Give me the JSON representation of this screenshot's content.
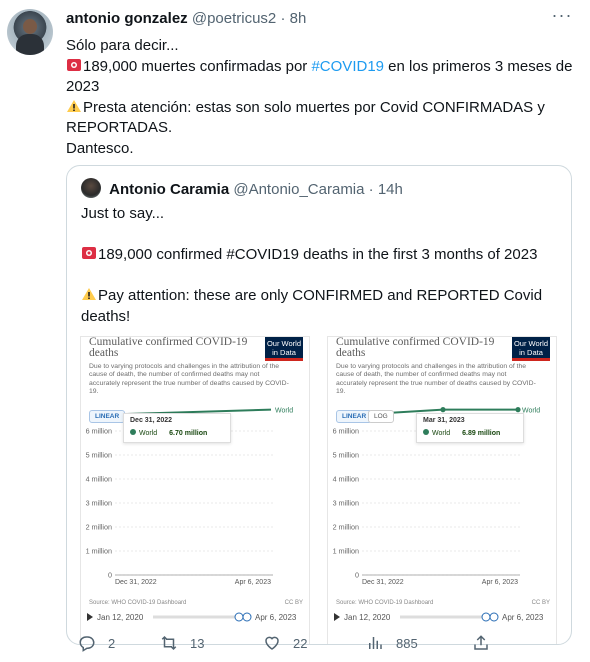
{
  "tweet": {
    "author_name": "antonio gonzalez",
    "handle": "@poetricus2",
    "separator": "·",
    "time": "8h",
    "lines": [
      "Sólo para decir...",
      "189,000 muertes confirmadas por ",
      "#COVID19",
      " en los primeros 3 meses de 2023",
      "Presta atención: estas son solo muertes por Covid CONFIRMADAS y REPORTADAS.",
      "Dantesco."
    ]
  },
  "quote": {
    "author_name": "Antonio Caramia",
    "handle": "@Antonio_Caramia",
    "separator": "·",
    "time": "14h",
    "lines": [
      "Just to say...",
      "189,000 confirmed #COVID19 deaths in the first 3 months of 2023",
      "Pay attention: these are only CONFIRMED and REPORTED Covid deaths!"
    ]
  },
  "charts": {
    "title": "Cumulative confirmed COVID-19 deaths",
    "subtitle": "Due to varying protocols and challenges in the attribution of the cause of death, the number of confirmed deaths may not accurately represent the true number of deaths caused by COVID-19.",
    "logo": "Our World in Data",
    "source": "Source: WHO COVID-19 Dashboard",
    "license": "CC BY",
    "linear_label": "LINEAR",
    "log_label": "LOG",
    "left": {
      "tooltip_date": "Dec 31, 2022",
      "series": "World",
      "tooltip_value": "6.70 million",
      "x_start": "Dec 31, 2022",
      "x_end": "Apr 6, 2023",
      "time_start": "Jan 12, 2020",
      "time_end": "Apr 6, 2023"
    },
    "right": {
      "tooltip_date": "Mar 31, 2023",
      "series": "World",
      "tooltip_value": "6.89 million",
      "x_start": "Dec 31, 2022",
      "x_end": "Apr 6, 2023",
      "time_start": "Jan 12, 2020",
      "time_end": "Apr 6, 2023"
    },
    "y_ticks": [
      "0",
      "1 million",
      "2 million",
      "3 million",
      "4 million",
      "5 million",
      "6 million"
    ]
  },
  "chart_data": [
    {
      "type": "line",
      "title": "Cumulative confirmed COVID-19 deaths",
      "series": [
        {
          "name": "World",
          "x": [
            "Dec 31, 2022",
            "Apr 6, 2023"
          ],
          "values": [
            6700000,
            6890000
          ]
        }
      ],
      "ylim": [
        0,
        7000000
      ],
      "y_ticks": [
        0,
        1000000,
        2000000,
        3000000,
        4000000,
        5000000,
        6000000
      ],
      "grid": true
    },
    {
      "type": "line",
      "title": "Cumulative confirmed COVID-19 deaths",
      "series": [
        {
          "name": "World",
          "x": [
            "Dec 31, 2022",
            "Mar 31, 2023",
            "Apr 6, 2023"
          ],
          "values": [
            6700000,
            6890000,
            6890000
          ]
        }
      ],
      "ylim": [
        0,
        7000000
      ],
      "y_ticks": [
        0,
        1000000,
        2000000,
        3000000,
        4000000,
        5000000,
        6000000
      ],
      "grid": true
    }
  ],
  "actions": {
    "replies": "2",
    "retweets": "13",
    "likes": "22",
    "views": "885"
  },
  "colors": {
    "link": "#1d9bf0",
    "muted": "#536471",
    "series": "#2e7d5b",
    "owid_navy": "#002147"
  }
}
